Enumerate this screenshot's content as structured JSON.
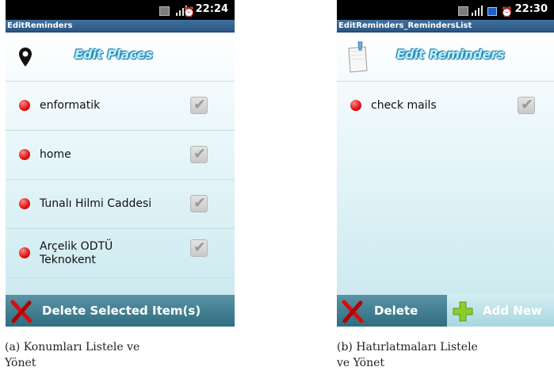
{
  "left_screen": {
    "status_time": "22:24",
    "app_title": "EditReminders",
    "header_title": "Edit Places",
    "places": [
      {
        "lines": [
          "enformatik"
        ],
        "checked": true
      },
      {
        "lines": [
          "home"
        ],
        "checked": true
      },
      {
        "lines": [
          "Tunalı Hilmi Caddesi"
        ],
        "checked": true
      },
      {
        "lines": [
          "Arçelik ODTÜ",
          "Teknokent"
        ],
        "checked": true
      }
    ],
    "delete_label": "Delete Selected Item(s)"
  },
  "right_screen": {
    "status_time": "22:30",
    "app_title": "EditReminders_RemindersList",
    "header_title": "Edit Reminders",
    "reminders": [
      {
        "label": "check mails",
        "checked": true
      }
    ],
    "delete_label": "Delete",
    "add_label": "Add New"
  },
  "captions": {
    "a_line1": "(a) Konumları Listele ve",
    "a_line2": "Yönet",
    "b_line1": "(b) Hatırlatmaları Listele",
    "b_line2": "ve Yönet"
  },
  "icons": {
    "location": "location-pin-icon",
    "note": "sticky-note-icon",
    "delete": "red-x-icon",
    "add": "green-plus-icon",
    "checkbox": "checkmark-icon"
  },
  "colors": {
    "title_bar": "#2b5683",
    "bottom_bar": "#3c7a8d",
    "bullet_red": "#e51717",
    "add_button_bg": "#b9dfe6"
  }
}
